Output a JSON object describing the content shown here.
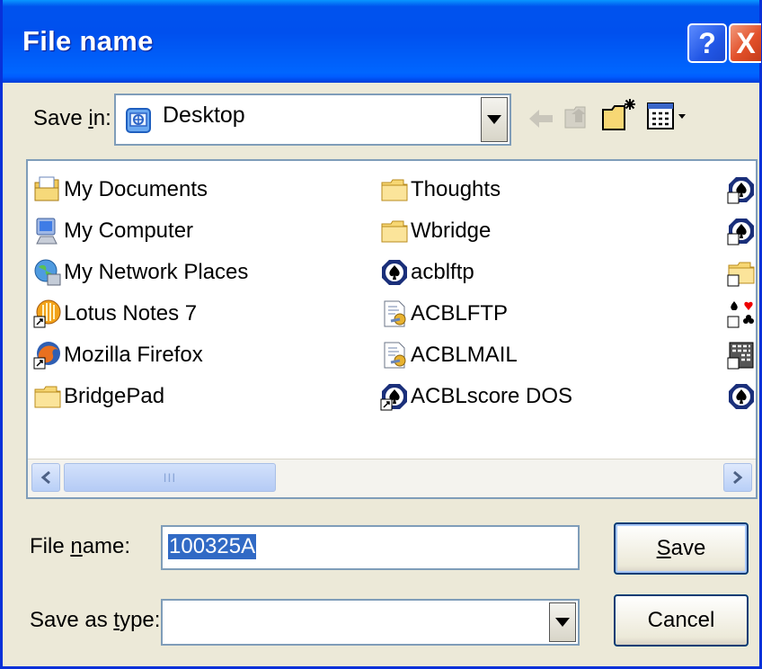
{
  "window": {
    "title": "File name",
    "help_label": "?",
    "close_label": "X"
  },
  "save_in": {
    "label_pre": "Save ",
    "label_key": "i",
    "label_post": "n:",
    "value": "Desktop"
  },
  "toolbar": {
    "icons": [
      "back-arrow-icon",
      "up-folder-icon",
      "new-folder-icon",
      "view-menu-icon"
    ]
  },
  "files": {
    "column1": [
      {
        "name": "My Documents",
        "icon": "my-documents-icon"
      },
      {
        "name": "My Computer",
        "icon": "my-computer-icon"
      },
      {
        "name": "My Network Places",
        "icon": "network-places-icon"
      },
      {
        "name": "Lotus Notes 7",
        "icon": "lotus-notes-shortcut-icon"
      },
      {
        "name": "Mozilla Firefox",
        "icon": "firefox-shortcut-icon"
      },
      {
        "name": "BridgePad",
        "icon": "folder-icon"
      }
    ],
    "column2": [
      {
        "name": "Thoughts",
        "icon": "folder-icon"
      },
      {
        "name": "Wbridge",
        "icon": "folder-icon"
      },
      {
        "name": "acblftp",
        "icon": "acbl-spade-icon"
      },
      {
        "name": "ACBLFTP",
        "icon": "script-file-icon"
      },
      {
        "name": "ACBLMAIL",
        "icon": "script-file-icon"
      },
      {
        "name": "ACBLscore DOS",
        "icon": "acbl-spade-shortcut-icon"
      }
    ],
    "column3_icons": [
      "acbl-spade-shortcut-icon",
      "acbl-spade-shortcut-icon",
      "folder-shortcut-icon",
      "card-suits-shortcut-icon",
      "calculator-shortcut-icon",
      "acbl-spade-icon"
    ]
  },
  "scrollbar": {
    "grip": "III"
  },
  "file_name": {
    "label_pre": "File ",
    "label_key": "n",
    "label_post": "ame:",
    "value": "100325A"
  },
  "save_as_type": {
    "label_pre": "Save as ",
    "label_key": "t",
    "label_post": "ype:",
    "value": ""
  },
  "buttons": {
    "save_key": "S",
    "save_rest": "ave",
    "cancel": "Cancel"
  },
  "colors": {
    "title_bar": "#0054e3",
    "selection": "#316ac5",
    "face": "#ece9d8"
  }
}
